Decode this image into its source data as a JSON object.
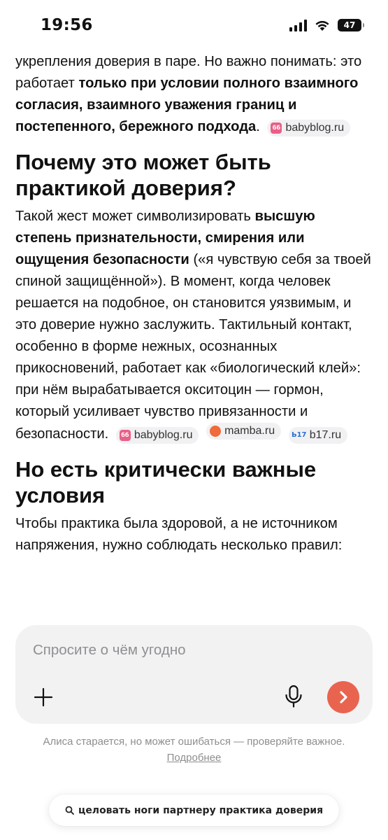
{
  "status_bar": {
    "time": "19:56",
    "battery": "47",
    "icons": [
      "signal-icon",
      "wifi-icon",
      "battery-icon"
    ]
  },
  "article": {
    "p1": {
      "text1": "укрепления доверия в паре. Но важно понимать: это работает ",
      "bold1": "только при условии полного взаимного согласия, взаимного уважения границ и постепенного, бережного подхода",
      "text2": "."
    },
    "h1": "Почему это может быть практикой доверия?",
    "p2": {
      "text1": "Такой жест может символизировать ",
      "bold1": "высшую степень признательности, смирения или ощущения безопасности",
      "text2": " («я чувствую себя за твоей спиной защищённой»). В момент, когда человек решается на подобное, он становится уязвимым, и это доверие нужно заслужить. Тактильный контакт, особенно в форме нежных, осознанных прикосновений, работает как «биологический клей»: при нём вырабатывается окситоцин — гормон, который усиливает чувство привязанности и безопасности."
    },
    "h2": "Но есть критически важные условия",
    "p3": "Чтобы практика была здоровой, а не источником напряжения, нужно соблюдать несколько правил:",
    "sources": {
      "babyblog": {
        "label": "babyblog.ru",
        "icon_text": "бб"
      },
      "mamba": {
        "label": "mamba.ru",
        "icon_text": ""
      },
      "b17": {
        "label": "b17.ru",
        "icon_text": "Ь17"
      }
    }
  },
  "ask": {
    "placeholder": "Спросите о чём угодно",
    "icons": [
      "plus-icon",
      "microphone-icon",
      "chevron-right-icon"
    ],
    "accent": "#e9644f"
  },
  "disclaimer": {
    "text": "Алиса старается, но может ошибаться — проверяйте важное. ",
    "link": "Подробнее"
  },
  "query": {
    "icon": "search-icon",
    "text": "целовать ноги партнеру практика доверия"
  }
}
